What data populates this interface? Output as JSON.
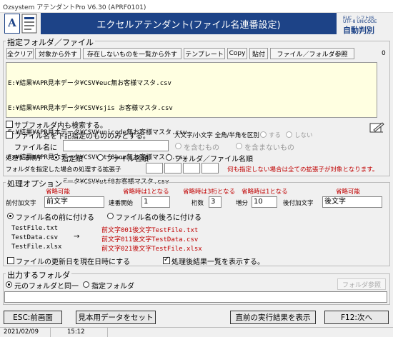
{
  "window": {
    "title": "Ozsystem アテンダントPro V6.30 (APRF0101)"
  },
  "header": {
    "banner_title": "エクセルアテンダント(ファイル名連番設定)",
    "logo_letter": "A",
    "right_logo_line1": "EUC　シフトJIS",
    "right_logo_line2": "UTF-8 UNICODE",
    "right_logo_line3": "自動判別"
  },
  "folder_section": {
    "label": "指定フォルダ／ファイル",
    "buttons": {
      "clear_all": "全クリア",
      "remove_target": "対象から外す",
      "remove_missing": "存在しないものを一覧から外す",
      "template": "テンプレート",
      "copy": "Copy",
      "paste": "貼付",
      "browse": "ファイル／フォルダ参照"
    },
    "count": "0",
    "files": [
      "E:¥結果¥APR見本データ¥CSV¥euc無お客様マスタ.csv",
      "E:¥結果¥APR見本データ¥CSV¥sjis お客様マスタ.csv",
      "E:¥結果¥APR見本データ¥CSV¥unicode無お客様マスタ.csv",
      "E:¥結果¥APR見本データ¥CSV¥utf8bom無お客様マスタ.csv",
      "E:¥結果¥APR見本データ¥CSV¥utf8お客様マスタ.csv"
    ],
    "subfolder_label": "サブフォルダ内も検索する。",
    "filter_label": "ファイル名を下記指定のもののみとする。",
    "case_label": "大文字/小文字 全角/半角を区別",
    "case_yes": "する",
    "case_no": "しない",
    "filename_prefix": "ファイル名に",
    "filename_value": "",
    "contain": "を含むもの",
    "not_contain": "を含まないもの",
    "order_label": "処理する順序",
    "order_options": [
      "指定順",
      "ファイル名順",
      "フォルダ／ファイル名順"
    ],
    "ext_label": "フォルダを指定した場合の処理する拡張子",
    "ext_note": "何も指定しない場合は全ての拡張子が対象となります。"
  },
  "options": {
    "label": "処理オプション",
    "omittable": "省略可能",
    "omit_start": "省略時は1となる",
    "omit_digits": "省略時は3桁となる",
    "omit_inc": "省略時は1となる",
    "omittable2": "省略可能",
    "prefix_label": "前付加文字",
    "prefix_value": "前文字",
    "start_label": "連番開始",
    "start_value": "1",
    "digits_label": "桁数",
    "digits_value": "3",
    "inc_label": "増分",
    "inc_value": "10",
    "suffix_label": "後付加文字",
    "suffix_value": "後文字",
    "before_name": "ファイル名の前に付ける",
    "after_name": "ファイル名の後ろに付ける",
    "examples_src": [
      "TestFile.txt",
      "TestData.csv",
      "TestFile.xlsx"
    ],
    "arrow": "→",
    "examples_dst": [
      "前文字001後文字TestFile.txt",
      "前文字011後文字TestData.csv",
      "前文字021後文字TestFile.xlsx"
    ],
    "update_time_label": "ファイルの更新日を現在日時にする",
    "show_results_label": "処理後結果一覧を表示する。"
  },
  "output": {
    "label": "出力するフォルダ",
    "same_folder": "元のフォルダと同一",
    "specified_folder": "指定フォルダ",
    "browse": "フォルダ参照",
    "path_value": ""
  },
  "footer": {
    "esc": "ESC:前画面",
    "sample": "見本用データをセット",
    "last_result": "直前の実行結果を表示",
    "next": "F12:次へ"
  },
  "status": {
    "date": "2021/02/09",
    "time": "15:12"
  },
  "colors": {
    "banner": "#1d4387",
    "list_bg": "#ffffe1",
    "note_red": "#c00000"
  }
}
